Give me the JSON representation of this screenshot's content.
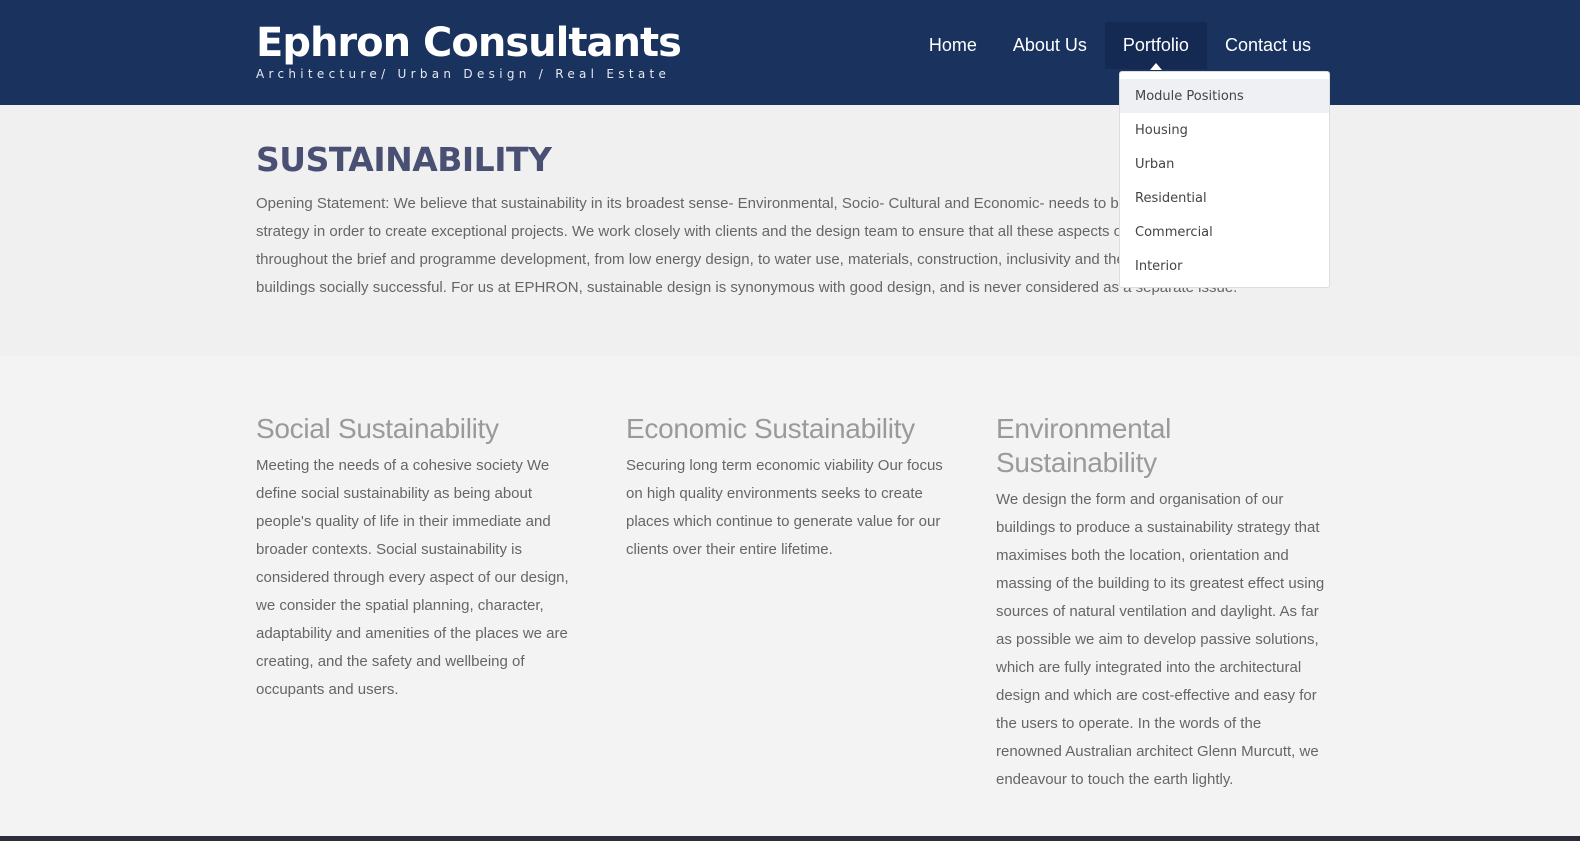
{
  "brand": {
    "title": "Ephron Consultants",
    "tagline": "Architecture/ Urban Design / Real Estate"
  },
  "nav": {
    "items": [
      "Home",
      "About Us",
      "Portfolio",
      "Contact us"
    ],
    "active": "Portfolio"
  },
  "dropdown": {
    "items": [
      "Module Positions",
      "Housing",
      "Urban",
      "Residential",
      "Commercial",
      "Interior"
    ],
    "highlighted": "Module Positions"
  },
  "intro": {
    "heading": "SUSTAINABILITY",
    "body": "Opening Statement: We believe that sustainability in its broadest sense- Environmental, Socio- Cultural and Economic- needs to be at the heart of the design strategy in order to create exceptional projects. We work closely with clients and the design team to ensure that all these aspects of sustainability are considered throughout the brief and programme development, from low energy design, to water use, materials, construction, inclusivity and the 'sense of place' that makes buildings socially successful. For us at EPHRON, sustainable design is synonymous with good design, and is never considered as a separate issue."
  },
  "columns": [
    {
      "heading": "Social Sustainability",
      "body": "Meeting the needs of a cohesive society We define social sustainability as being about people's quality of life in their immediate and broader contexts. Social sustainability is considered through every aspect of our design, we consider the spatial planning, character, adaptability and amenities of the places we are creating, and the safety and wellbeing of occupants and users."
    },
    {
      "heading": "Economic Sustainability",
      "body": "Securing long term economic viability Our focus on high quality environments seeks to create places which continue to generate value for our clients over their entire lifetime."
    },
    {
      "heading": "Environmental Sustainability",
      "body": "We design the form and organisation of our buildings to produce a sustainability strategy that maximises both the location, orientation and massing of the building to its greatest effect using sources of natural ventilation and daylight. As far as possible we aim to develop passive solutions, which are fully integrated into the architectural design and which are cost-effective and easy for the users to operate. In the words of the renowned Australian architect Glenn Murcutt, we endeavour to touch the earth lightly."
    }
  ],
  "colors": {
    "header_bg": "#19325e",
    "active_nav_bg": "#142a52",
    "heading": "#4a4f74",
    "page_bg": "#f0f0f0"
  }
}
